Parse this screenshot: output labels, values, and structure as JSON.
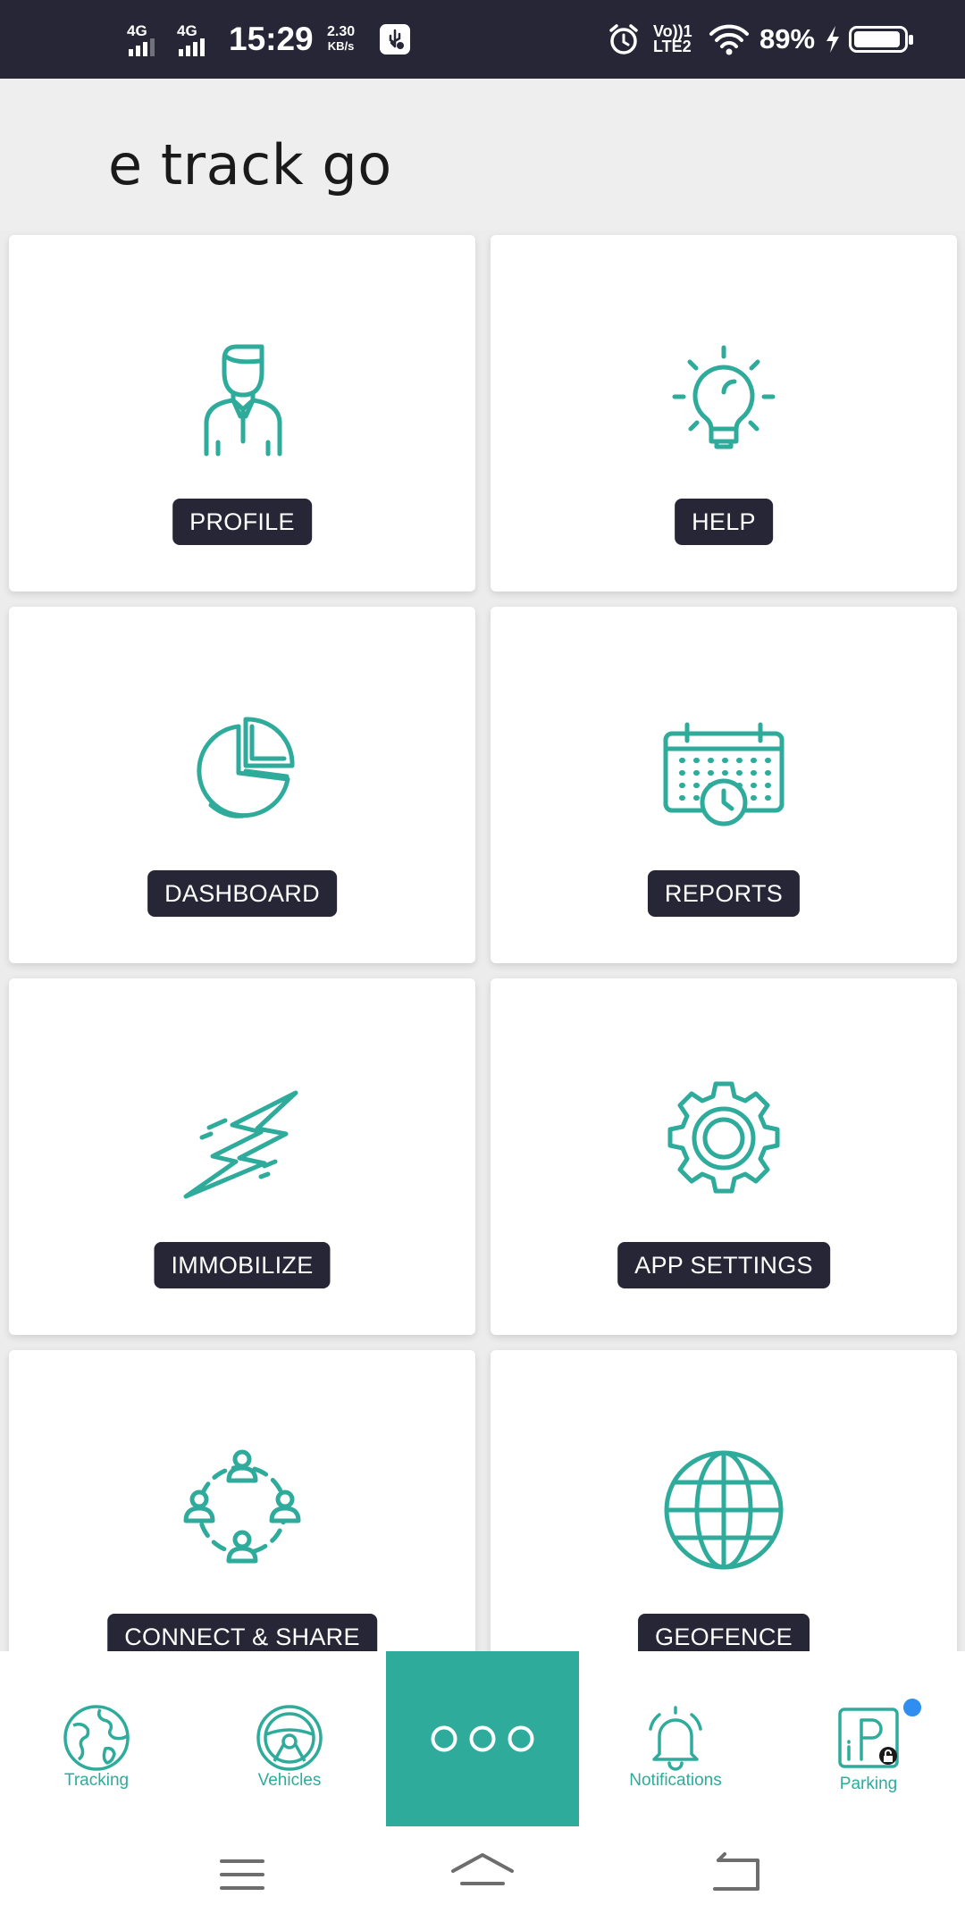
{
  "status_bar": {
    "network_1": "4G",
    "network_2": "4G",
    "time": "15:29",
    "speed_value": "2.30",
    "speed_unit": "KB/s",
    "volte_line1": "Vo))1",
    "volte_line2": "LTE2",
    "battery_percent": "89%",
    "icons": [
      "usb-debug-icon",
      "alarm-icon",
      "wifi-icon",
      "charging-bolt-icon",
      "battery-icon"
    ]
  },
  "header": {
    "title": "e track go"
  },
  "tiles": [
    {
      "label": "PROFILE",
      "icon": "person-icon"
    },
    {
      "label": "HELP",
      "icon": "lightbulb-icon"
    },
    {
      "label": "DASHBOARD",
      "icon": "pie-chart-icon"
    },
    {
      "label": "REPORTS",
      "icon": "calendar-clock-icon"
    },
    {
      "label": "IMMOBILIZE",
      "icon": "lightning-icon"
    },
    {
      "label": "APP SETTINGS",
      "icon": "gear-icon"
    },
    {
      "label": "CONNECT & SHARE",
      "icon": "people-network-icon"
    },
    {
      "label": "GEOFENCE",
      "icon": "globe-icon"
    }
  ],
  "bottom_nav": {
    "items": [
      {
        "label": "Tracking",
        "icon": "earth-icon"
      },
      {
        "label": "Vehicles",
        "icon": "steering-wheel-icon"
      },
      {
        "label": "",
        "icon": "more-dots-icon"
      },
      {
        "label": "Notifications",
        "icon": "bell-icon"
      },
      {
        "label": "Parking",
        "icon": "parking-icon"
      }
    ]
  },
  "colors": {
    "accent": "#2eab9b",
    "dark": "#262637",
    "badge": "#2f8ef0",
    "background": "#ececec"
  }
}
